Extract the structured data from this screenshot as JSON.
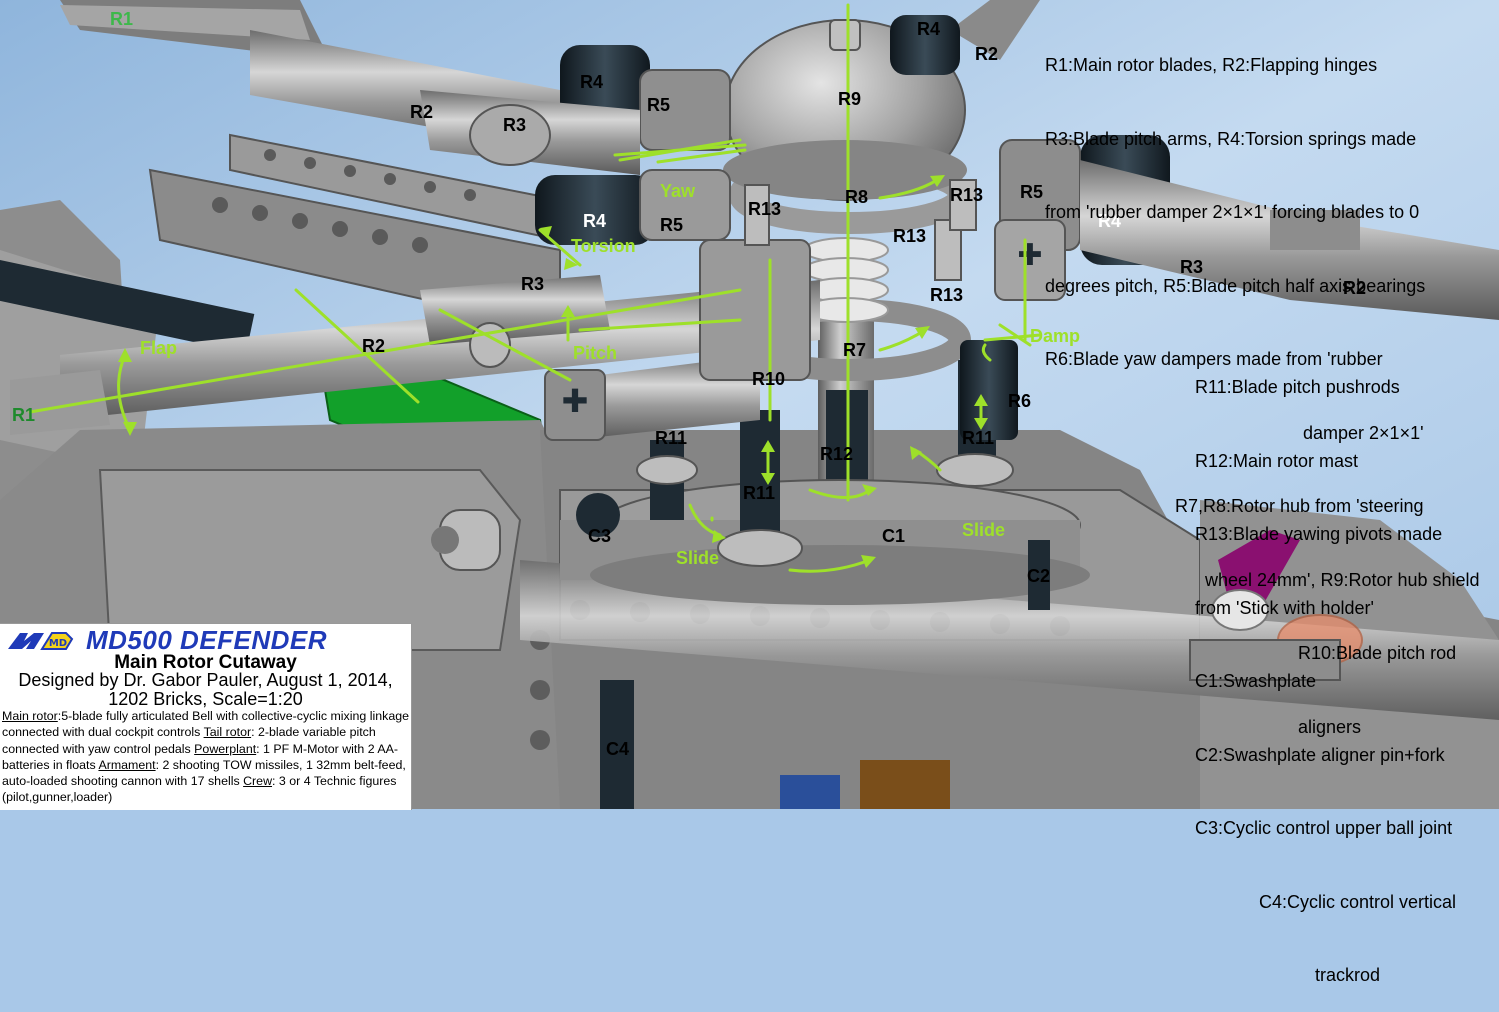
{
  "legend": {
    "right_lines": [
      "R1:Main rotor blades, R2:Flapping hinges",
      "R3:Blade pitch arms, R4:Torsion springs made",
      "from 'rubber damper 2×1×1' forcing blades to 0",
      "degrees pitch, R5:Blade pitch half axis bearings",
      "R6:Blade yaw dampers made from 'rubber",
      "damper 2×1×1'",
      "R7,R8:Rotor hub from 'steering",
      "wheel 24mm', R9:Rotor hub shield",
      "R10:Blade pitch rod",
      "aligners"
    ],
    "lower_lines": [
      "R11:Blade pitch pushrods",
      "R12:Main rotor mast",
      "R13:Blade yawing pivots made",
      "from 'Stick with holder'",
      "C1:Swashplate",
      "C2:Swashplate aligner pin+fork",
      "C3:Cyclic control upper ball joint",
      "C4:Cyclic control vertical",
      "trackrod"
    ]
  },
  "labels": {
    "r1_top": "R1",
    "r1_left": "R1",
    "r2_a": "R2",
    "r2_b": "R2",
    "r2_c": "R2",
    "r2_d": "R2",
    "r3_a": "R3",
    "r3_b": "R3",
    "r3_c": "R3",
    "r4_a": "R4",
    "r4_b": "R4",
    "r4_c": "R4",
    "r4_d": "R4",
    "r5_a": "R5",
    "r5_b": "R5",
    "r5_c": "R5",
    "r6": "R6",
    "r7": "R7",
    "r8": "R8",
    "r9": "R9",
    "r10": "R10",
    "r11_a": "R11",
    "r11_b": "R11",
    "r11_c": "R11",
    "r12": "R12",
    "r13_a": "R13",
    "r13_b": "R13",
    "r13_c": "R13",
    "r13_d": "R13",
    "c1": "C1",
    "c2": "C2",
    "c3": "C3",
    "c4": "C4",
    "flap": "Flap",
    "pitch": "Pitch",
    "yaw": "Yaw",
    "torsion": "Torsion",
    "damp": "Damp",
    "slide_a": "Slide",
    "slide_b": "Slide"
  },
  "title_box": {
    "logo_text": "MD",
    "model_title": "MD500 DEFENDER",
    "cutaway": "Main Rotor Cutaway",
    "designer_line1": "Designed by Dr. Gabor Pauler, August 1, 2014,",
    "designer_line2": "1202 Bricks, Scale=1:20",
    "main_rotor_head": "Main rotor",
    "main_rotor_text": ":5-blade fully articulated Bell with collective-cyclic mixing linkage connected with dual cockpit controls ",
    "tail_rotor_head": "Tail rotor",
    "tail_rotor_text": ": 2-blade variable pitch connected with yaw control pedals ",
    "powerplant_head": "Powerplant",
    "powerplant_text": ": 1 PF M-Motor with 2 AA-batteries in floats ",
    "armament_head": "Armament",
    "armament_text": ": 2 shooting TOW missiles, 1 32mm belt-feed, auto-loaded shooting cannon with 17 shells ",
    "crew_head": "Crew",
    "crew_text": ": 3 or 4 Technic figures (pilot,gunner,loader)"
  },
  "colors": {
    "sky": "#a9c8e8",
    "plastic_gray": "#8c8c8c",
    "dark_bluish": "#1e2a33",
    "label_green": "#9ee02a",
    "title_blue": "#1f3ab8",
    "logo_yellow": "#f2d21a",
    "accent_green": "#12a02a",
    "magenta": "#8a1070",
    "trans_orange": "#e88c6a"
  }
}
